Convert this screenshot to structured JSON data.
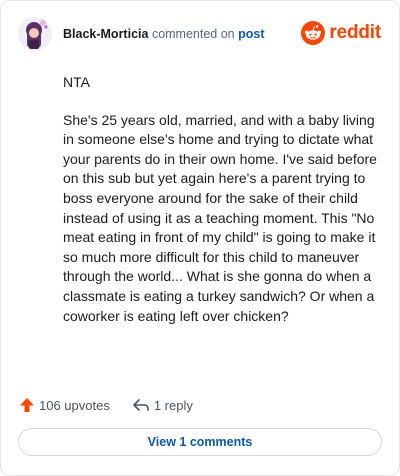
{
  "comment": {
    "author": "Black-Morticia",
    "verb": "commented on",
    "post_link": "post",
    "paragraphs": [
      "NTA",
      "She's 25 years old, married, and with a baby living in someone else's home and trying to dictate what your parents do in their own home. I've said before on this sub but yet again here's a parent trying to boss everyone around for the sake of their child instead of using it as a teaching moment. This \"No meat eating in front of my child\" is going to make it so much more difficult for this child to maneuver through the world... What is she gonna do when a classmate is eating a turkey sandwich? Or when a coworker is eating left over chicken?"
    ]
  },
  "brand": {
    "wordmark": "reddit",
    "icon": "reddit-alien-icon",
    "color": "#ff4500"
  },
  "actions": {
    "upvotes_label": "106 upvotes",
    "upvote_icon": "upvote-arrow-icon",
    "upvote_color": "#ff4500",
    "reply_label": "1 reply",
    "reply_icon": "reply-arrow-icon"
  },
  "footer": {
    "view_comments_label": "View 1 comments"
  }
}
